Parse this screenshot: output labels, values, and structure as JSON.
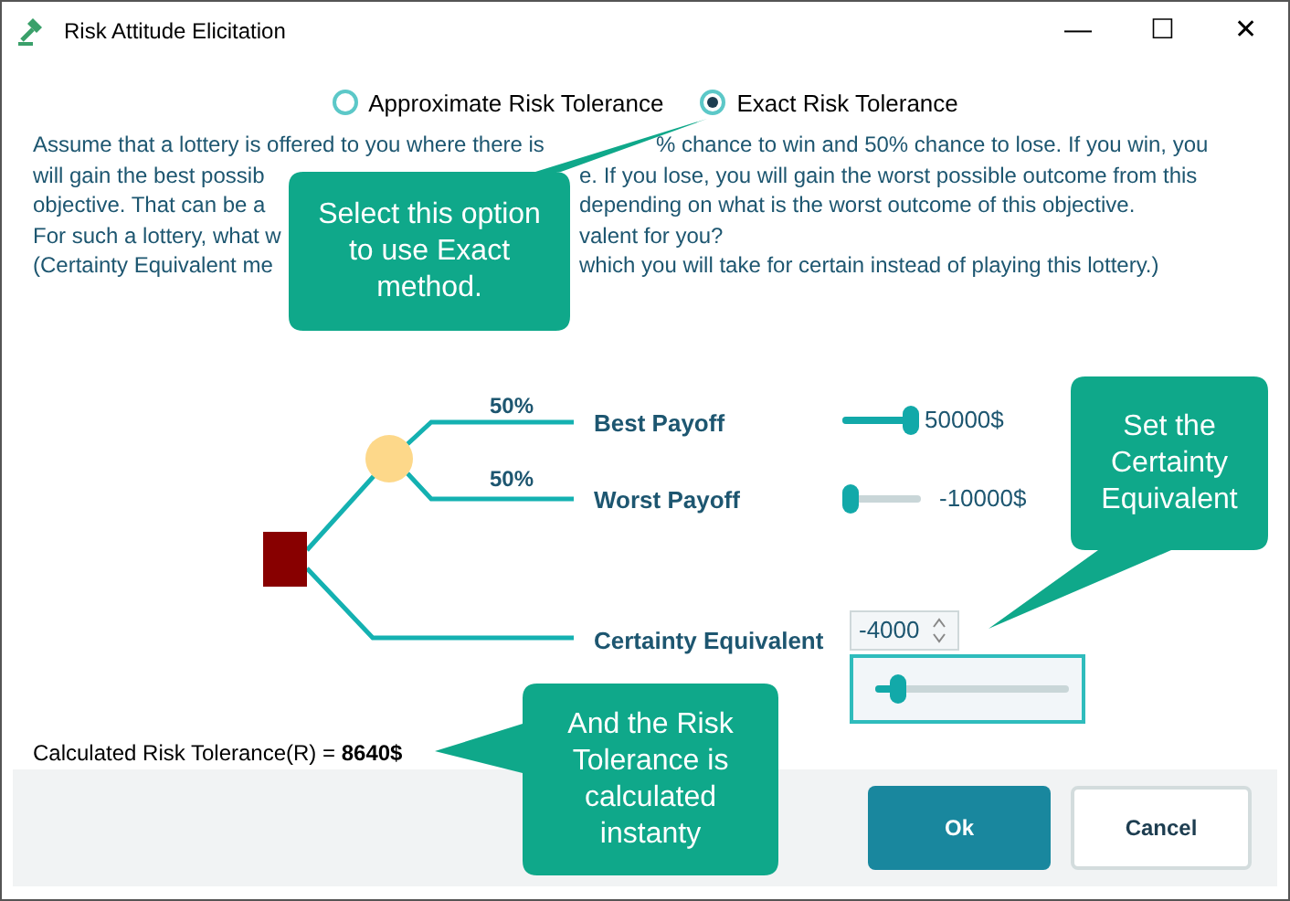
{
  "window": {
    "title": "Risk Attitude Elicitation",
    "controls": [
      "—",
      "☐",
      "✕"
    ]
  },
  "options": [
    {
      "label": "Approximate Risk Tolerance",
      "selected": false
    },
    {
      "label": "Exact Risk Tolerance",
      "selected": true
    }
  ],
  "description_lines": [
    [
      "Assume that a lottery is offered to you where there is",
      "% chance to win and 50% chance to lose. If you win, you"
    ],
    [
      "will gain the best possib",
      "e. If you lose, you will gain the worst possible outcome from this"
    ],
    [
      "objective. That can be a",
      "depending on what is the worst outcome of this objective."
    ],
    [
      "For such a lottery, what w",
      "valent for you?"
    ],
    [
      "(Certainty Equivalent me",
      "which you will take for certain instead of playing this lottery.)"
    ]
  ],
  "tree": {
    "best": {
      "probability": "50%",
      "label": "Best Payoff",
      "level": 1,
      "value": "50000$"
    },
    "worst": {
      "probability": "50%",
      "label": "Worst Payoff",
      "level": 0,
      "value": "-10000$"
    },
    "certainty": {
      "label": "Certainty Equivalent",
      "value": "-4000",
      "level": 0.08
    }
  },
  "result": {
    "label": "Calculated Risk Tolerance(R) = ",
    "value": "8640$"
  },
  "buttons": [
    {
      "label": "Ok",
      "kind": "primary"
    },
    {
      "label": "Cancel",
      "kind": "secondary"
    }
  ],
  "callouts": [
    {
      "text": "Select this option to use Exact method."
    },
    {
      "text": "Set the Certainty Equivalent"
    },
    {
      "text": "And the Risk Tolerance is calculated instanty"
    }
  ]
}
